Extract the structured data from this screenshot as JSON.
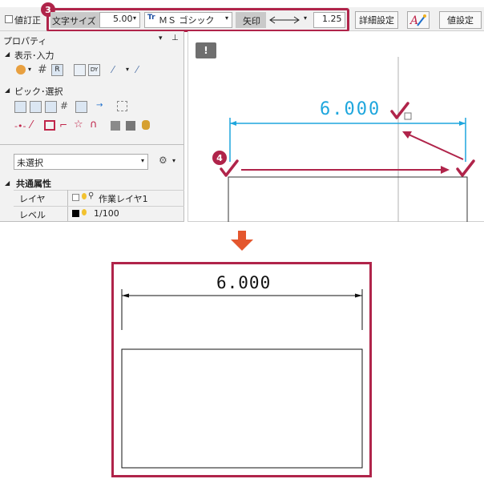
{
  "toolbar": {
    "correction_label": "値訂正",
    "text_size_label": "文字サイズ",
    "text_size_value": "5.00",
    "font_value": "ＭＳ ゴシック",
    "arrow_label": "矢印",
    "arrow_scale_value": "1.25",
    "detail_button": "詳細設定",
    "value_setting_button": "値設定"
  },
  "badges": {
    "step3": "3",
    "step4": "4"
  },
  "property_panel": {
    "title": "プロパティ",
    "sections": {
      "display_input": "表示･入力",
      "pick_select": "ピック･選択"
    },
    "selection_value": "未選択",
    "common_attributes": "共通属性",
    "rows": [
      {
        "label": "レイヤ",
        "value": "作業レイヤ1"
      },
      {
        "label": "レベル",
        "value": "1/100"
      }
    ]
  },
  "canvas": {
    "dimension_value": "6.000"
  },
  "result": {
    "dimension_value": "6.000"
  },
  "colors": {
    "accent": "#b0244a",
    "dimension_cyan": "#1ea6dd",
    "arrow_orange": "#e4572e"
  }
}
